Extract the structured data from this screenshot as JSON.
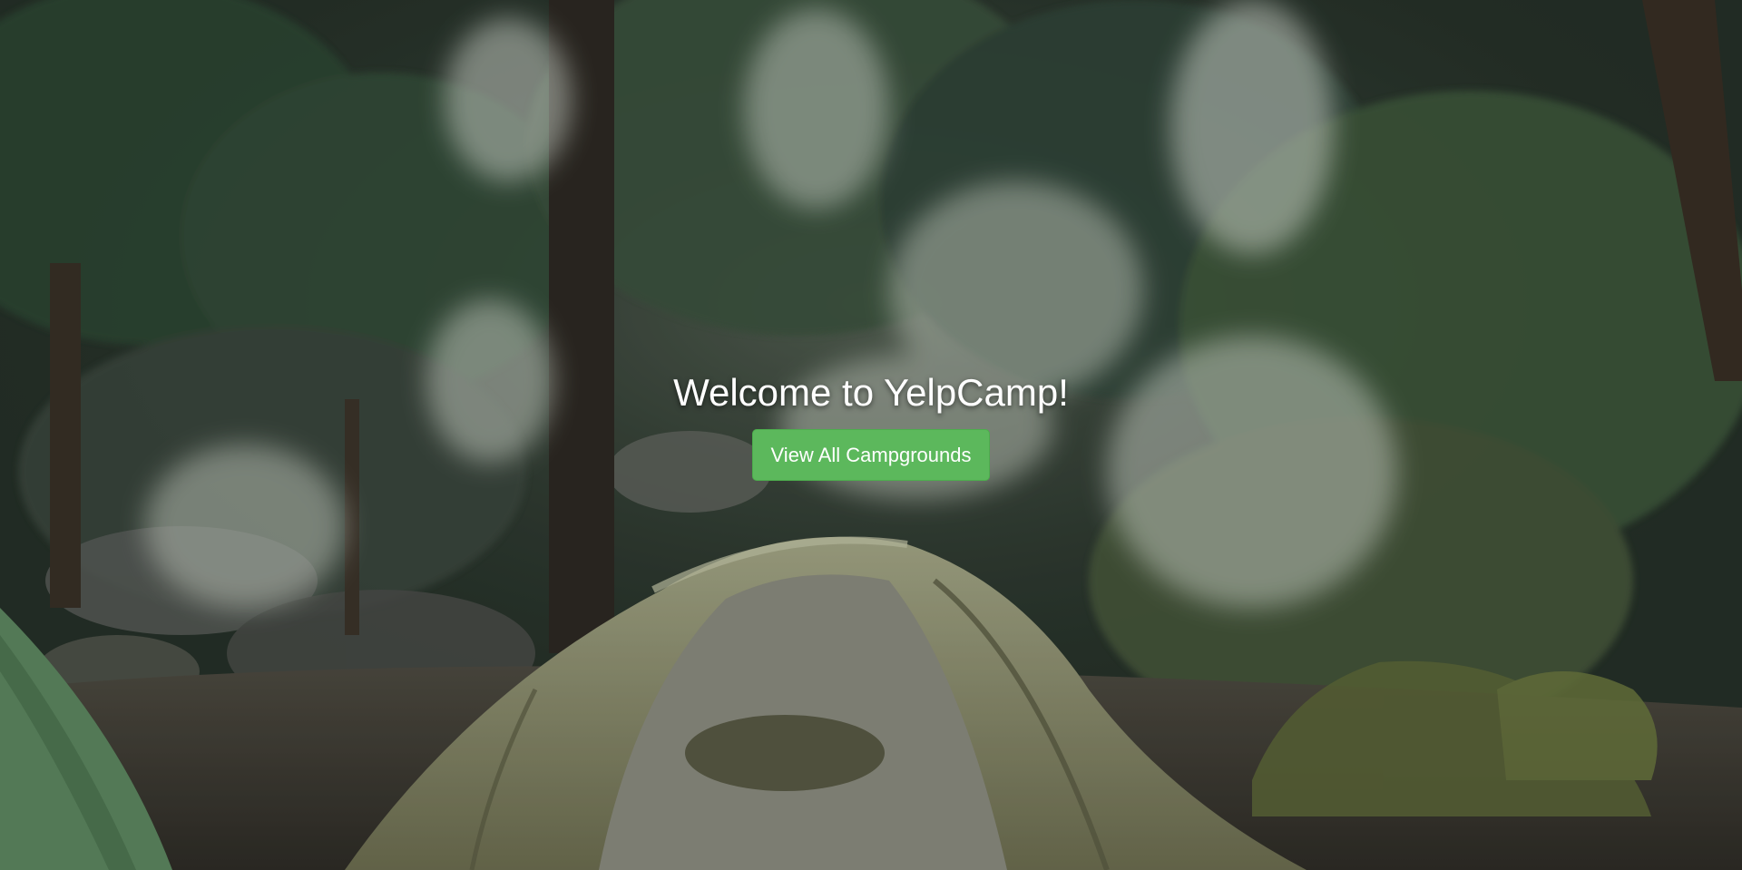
{
  "hero": {
    "title": "Welcome to YelpCamp!",
    "cta_label": "View All Campgrounds"
  },
  "colors": {
    "cta_background": "#5cb85c",
    "title_text": "#ffffff"
  },
  "background": {
    "scene": "forest campsite with tents and drifting smoke"
  }
}
